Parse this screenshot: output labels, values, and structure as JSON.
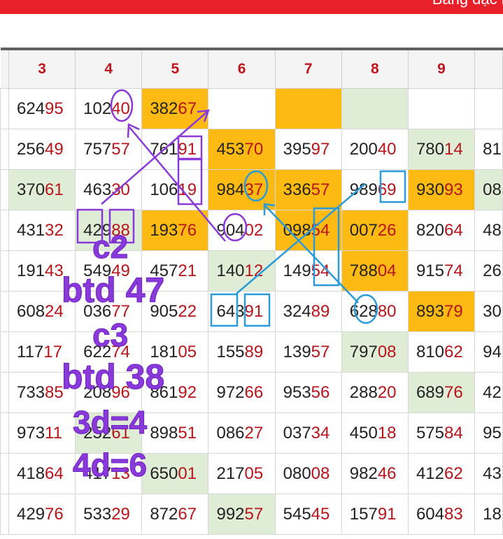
{
  "header": {
    "title_fragment": "Bảng đặc b"
  },
  "table": {
    "columns": [
      "",
      "3",
      "4",
      "5",
      "6",
      "7",
      "8",
      "9",
      ""
    ],
    "rows": [
      [
        "",
        "62495",
        "10240",
        "38267",
        "",
        "",
        "",
        "",
        ""
      ],
      [
        "",
        "25649",
        "75757",
        "76191",
        "45370",
        "39597",
        "20040",
        "78014",
        "81"
      ],
      [
        "",
        "37061",
        "46330",
        "10619",
        "98437",
        "33657",
        "98969",
        "93093",
        "08"
      ],
      [
        "",
        "43132",
        "42988",
        "19376",
        "90402",
        "09854",
        "00726",
        "82064",
        "48"
      ],
      [
        "",
        "19143",
        "54949",
        "45721",
        "14012",
        "14954",
        "78804",
        "91574",
        "26"
      ],
      [
        "",
        "60824",
        "03677",
        "90522",
        "64391",
        "32489",
        "62880",
        "89379",
        "30"
      ],
      [
        "",
        "11717",
        "62274",
        "18105",
        "15589",
        "13957",
        "79708",
        "81062",
        "94"
      ],
      [
        "",
        "73385",
        "20896",
        "86192",
        "97266",
        "95356",
        "28820",
        "68976",
        "42"
      ],
      [
        "",
        "97311",
        "25261",
        "89851",
        "08627",
        "03734",
        "45018",
        "57584",
        "95"
      ],
      [
        "",
        "41864",
        "41713",
        "65001",
        "21705",
        "08008",
        "98246",
        "41262",
        "43"
      ],
      [
        "",
        "42976",
        "53329",
        "87267",
        "99257",
        "54545",
        "15791",
        "60483",
        "18"
      ]
    ],
    "highlights": [
      {
        "row": 0,
        "col": 2,
        "color": "#fdba12"
      },
      {
        "row": 0,
        "col": 4,
        "color": "#fdba12"
      },
      {
        "row": 0,
        "col": 5,
        "color": "#dfedd6"
      },
      {
        "row": 1,
        "col": 3,
        "color": "#fdba12"
      },
      {
        "row": 1,
        "col": 6,
        "color": "#dfedd6"
      },
      {
        "row": 2,
        "col": 0,
        "color": "#dfedd6"
      },
      {
        "row": 2,
        "col": 3,
        "color": "#fdba12"
      },
      {
        "row": 2,
        "col": 4,
        "color": "#fdba12"
      },
      {
        "row": 2,
        "col": 6,
        "color": "#fdba12"
      },
      {
        "row": 2,
        "col": 7,
        "color": "#dfedd6"
      },
      {
        "row": 3,
        "col": 1,
        "color": "#dfedd6"
      },
      {
        "row": 3,
        "col": 2,
        "color": "#fdba12"
      },
      {
        "row": 3,
        "col": 4,
        "color": "#fdba12"
      },
      {
        "row": 3,
        "col": 5,
        "color": "#fdba12"
      },
      {
        "row": 3,
        "col": 8,
        "color": "#dfedd6"
      },
      {
        "row": 4,
        "col": 3,
        "color": "#dfedd6"
      },
      {
        "row": 4,
        "col": 5,
        "color": "#fdba12"
      },
      {
        "row": 5,
        "col": 6,
        "color": "#fdba12"
      },
      {
        "row": 6,
        "col": 5,
        "color": "#dfedd6"
      },
      {
        "row": 7,
        "col": 6,
        "color": "#dfedd6"
      },
      {
        "row": 8,
        "col": 1,
        "color": "#dfedd6"
      },
      {
        "row": 8,
        "col": 8,
        "color": "#dfedd6"
      },
      {
        "row": 9,
        "col": 2,
        "color": "#dfedd6"
      },
      {
        "row": 10,
        "col": 3,
        "color": "#dfedd6"
      }
    ]
  },
  "annotations": {
    "notes": [
      "c2",
      "btd 47",
      "c3",
      "btd 38",
      "3d=4",
      "4d=6"
    ],
    "purple_color": "#8a3ad8",
    "blue_color": "#2a9ad8"
  },
  "colors": {
    "topbar": "#e8202a",
    "header_text": "#c0151c",
    "number_tail": "#b8141a",
    "orange_cell": "#fdba12",
    "green_cell": "#dfedd6"
  }
}
